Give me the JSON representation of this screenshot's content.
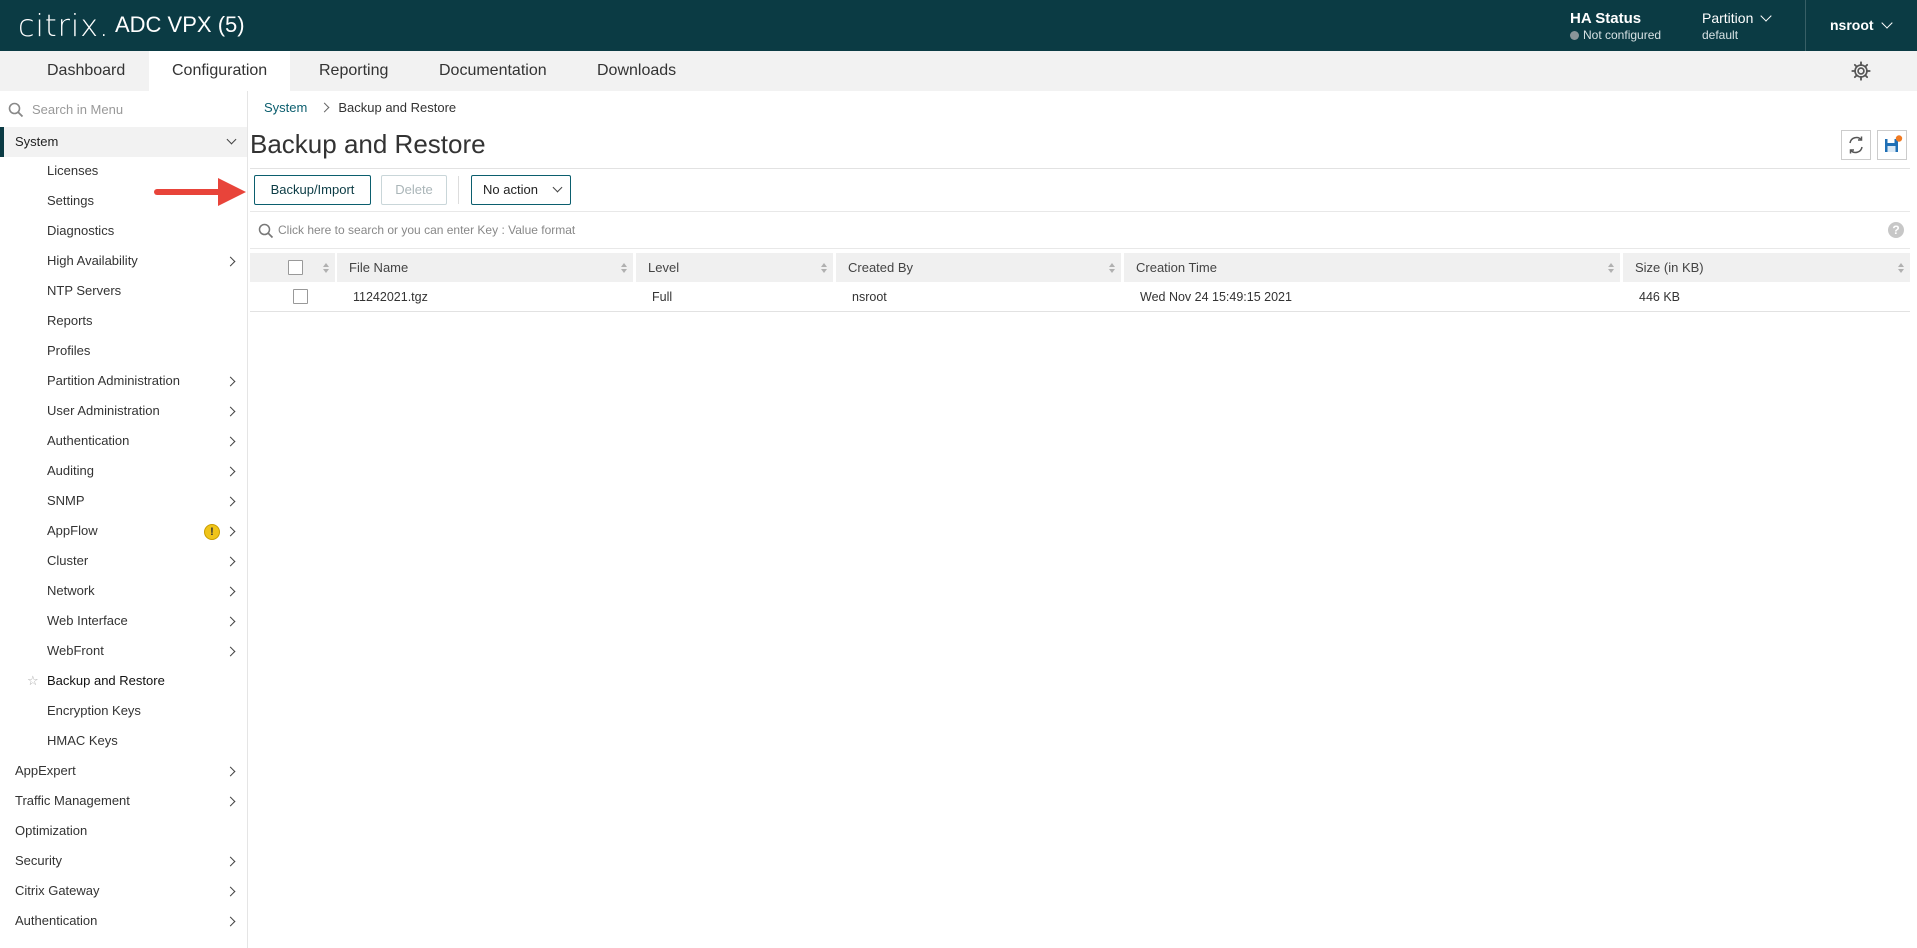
{
  "header": {
    "logo_text": "citrix.",
    "app_title": "ADC VPX (5)",
    "ha_status_label": "HA Status",
    "ha_status_value": "Not configured",
    "partition_label": "Partition",
    "partition_value": "default",
    "user": "nsroot"
  },
  "nav": {
    "tabs": [
      {
        "label": "Dashboard"
      },
      {
        "label": "Configuration",
        "active": true
      },
      {
        "label": "Reporting"
      },
      {
        "label": "Documentation"
      },
      {
        "label": "Downloads"
      }
    ]
  },
  "sidebar": {
    "search_placeholder": "Search in Menu",
    "system_label": "System",
    "system_items": [
      {
        "label": "Licenses"
      },
      {
        "label": "Settings"
      },
      {
        "label": "Diagnostics"
      },
      {
        "label": "High Availability",
        "expandable": true
      },
      {
        "label": "NTP Servers"
      },
      {
        "label": "Reports"
      },
      {
        "label": "Profiles"
      },
      {
        "label": "Partition Administration",
        "expandable": true
      },
      {
        "label": "User Administration",
        "expandable": true
      },
      {
        "label": "Authentication",
        "expandable": true
      },
      {
        "label": "Auditing",
        "expandable": true
      },
      {
        "label": "SNMP",
        "expandable": true
      },
      {
        "label": "AppFlow",
        "expandable": true,
        "warning": true
      },
      {
        "label": "Cluster",
        "expandable": true
      },
      {
        "label": "Network",
        "expandable": true
      },
      {
        "label": "Web Interface",
        "expandable": true
      },
      {
        "label": "WebFront",
        "expandable": true
      },
      {
        "label": "Backup and Restore",
        "active": true
      },
      {
        "label": "Encryption Keys"
      },
      {
        "label": "HMAC Keys"
      }
    ],
    "top_items": [
      {
        "label": "AppExpert",
        "expandable": true
      },
      {
        "label": "Traffic Management",
        "expandable": true
      },
      {
        "label": "Optimization"
      },
      {
        "label": "Security",
        "expandable": true
      },
      {
        "label": "Citrix Gateway",
        "expandable": true
      },
      {
        "label": "Authentication",
        "expandable": true
      }
    ]
  },
  "breadcrumb": {
    "parent": "System",
    "current": "Backup and Restore"
  },
  "page": {
    "title": "Backup and Restore",
    "backup_button": "Backup/Import",
    "delete_button": "Delete",
    "action_select": "No action",
    "search_placeholder": "Click here to search or you can enter Key : Value format",
    "help_icon_text": "?"
  },
  "table": {
    "columns": [
      "File Name",
      "Level",
      "Created By",
      "Creation Time",
      "Size (in KB)"
    ],
    "rows": [
      {
        "file_name": "11242021.tgz",
        "level": "Full",
        "created_by": "nsroot",
        "creation_time": "Wed Nov 24 15:49:15 2021",
        "size": "446 KB"
      }
    ]
  },
  "colors": {
    "header_bg": "#0b3b44",
    "accent": "#0b5e6e",
    "annotation_arrow": "#e8443a",
    "warning": "#f0c419"
  }
}
